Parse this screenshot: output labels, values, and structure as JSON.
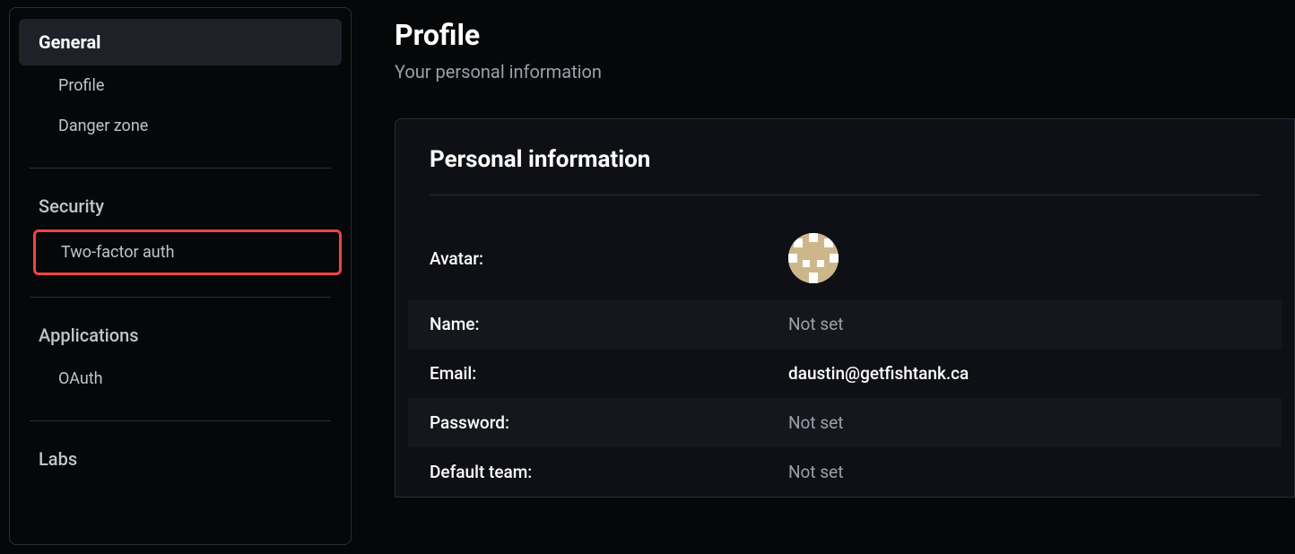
{
  "sidebar": {
    "sections": [
      {
        "heading": "General",
        "active": true,
        "items": [
          {
            "label": "Profile"
          },
          {
            "label": "Danger zone"
          }
        ]
      },
      {
        "heading": "Security",
        "active": false,
        "items": [
          {
            "label": "Two-factor auth",
            "highlighted": true
          }
        ]
      },
      {
        "heading": "Applications",
        "active": false,
        "items": [
          {
            "label": "OAuth"
          }
        ]
      }
    ],
    "labs": "Labs"
  },
  "page": {
    "title": "Profile",
    "subtitle": "Your personal information"
  },
  "panel": {
    "title": "Personal information",
    "rows": [
      {
        "label": "Avatar:",
        "type": "avatar"
      },
      {
        "label": "Name:",
        "value": "Not set",
        "muted": true,
        "alt": true
      },
      {
        "label": "Email:",
        "value": "daustin@getfishtank.ca",
        "muted": false,
        "alt": false
      },
      {
        "label": "Password:",
        "value": "Not set",
        "muted": true,
        "alt": true
      },
      {
        "label": "Default team:",
        "value": "Not set",
        "muted": true,
        "alt": false
      }
    ]
  }
}
